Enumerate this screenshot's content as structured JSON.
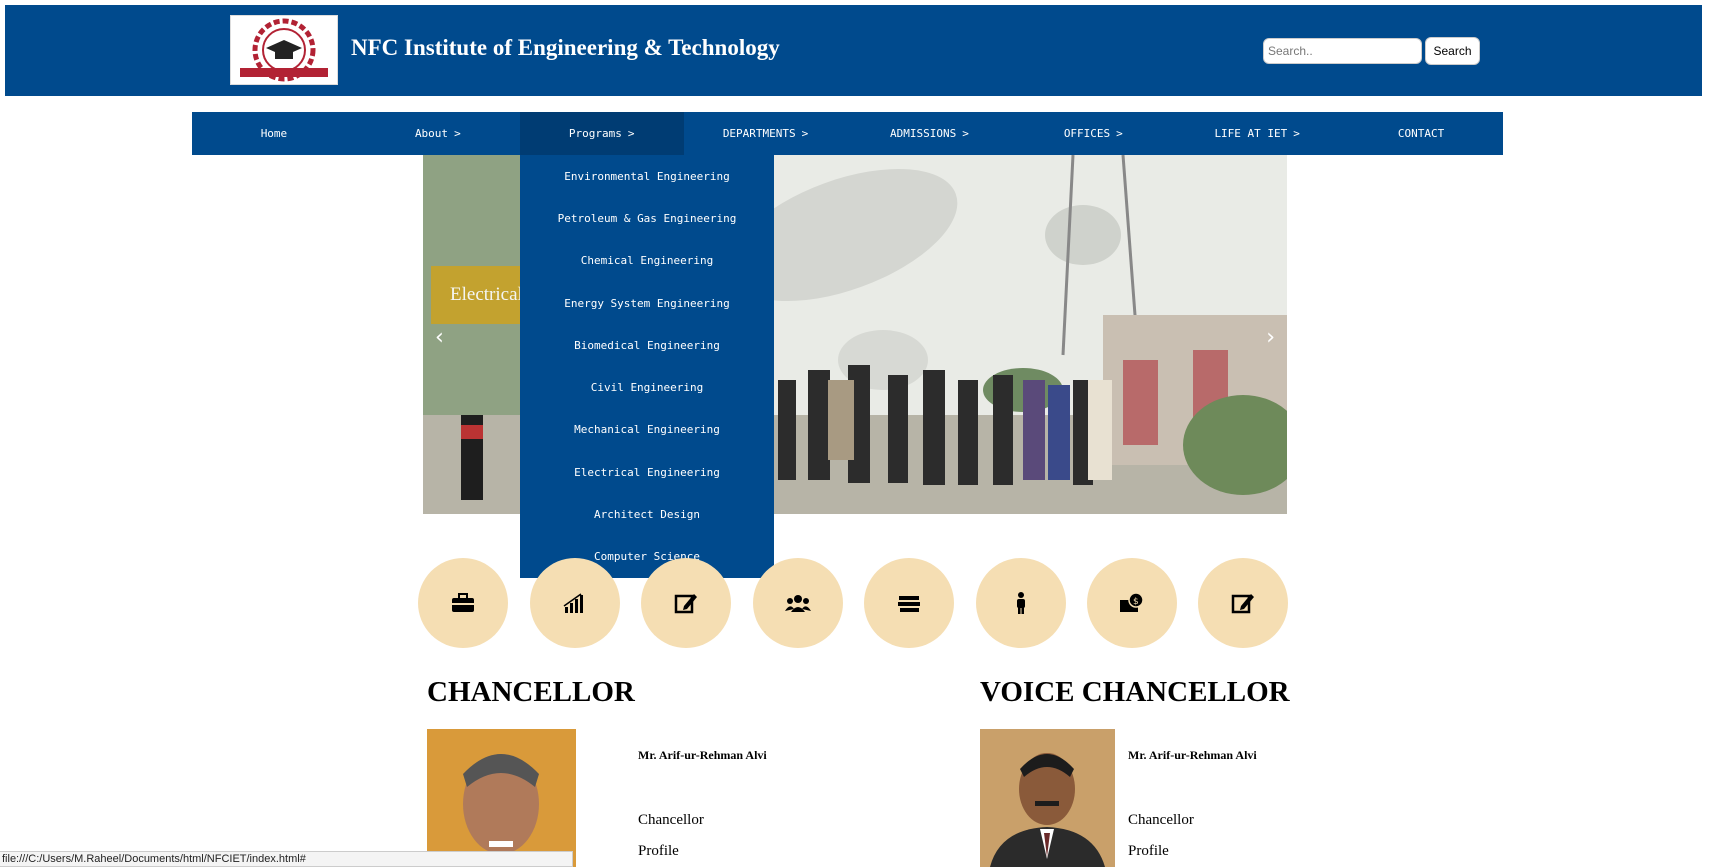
{
  "header": {
    "title": "NFC Institute of Engineering & Technology",
    "search_placeholder": "Search..",
    "search_button": "Search",
    "background": "#004a8d"
  },
  "nav": {
    "items": [
      {
        "label": "Home"
      },
      {
        "label": "About",
        "chevron": ">"
      },
      {
        "label": "Programs",
        "chevron": ">"
      },
      {
        "label": "DEPARTMENTS",
        "chevron": ">"
      },
      {
        "label": "ADMISSIONS",
        "chevron": ">"
      },
      {
        "label": "OFFICES",
        "chevron": ">"
      },
      {
        "label": "LIFE AT IET",
        "chevron": ">"
      },
      {
        "label": "CONTACT"
      }
    ],
    "active": "Programs"
  },
  "programs_menu": {
    "items": [
      "Environmental Engineering",
      "Petroleum & Gas Engineering",
      "Chemical Engineering",
      "Energy System Engineering",
      "Biomedical Engineering",
      "Civil Engineering",
      "Mechanical Engineering",
      "Electrical Engineering",
      "Architect Design",
      "Computer Science"
    ]
  },
  "slider": {
    "caption": "Electrical",
    "prev": "‹",
    "next": "›"
  },
  "quick_links": {
    "icons": [
      "briefcase-icon",
      "bar-chart-icon",
      "edit-icon",
      "users-icon",
      "books-icon",
      "person-icon",
      "money-icon",
      "edit-icon"
    ],
    "color": "#f5deb3"
  },
  "chancellor": {
    "heading": "CHANCELLOR",
    "name": "Mr. Arif-ur-Rehman Alvi",
    "role": "Chancellor",
    "profile": "Profile"
  },
  "vice_chancellor": {
    "heading": "VOICE CHANCELLOR",
    "name": "Mr. Arif-ur-Rehman Alvi",
    "role": "Chancellor",
    "profile": "Profile"
  },
  "status_bar": {
    "url": "file:///C:/Users/M.Raheel/Documents/html/NFCIET/index.html#"
  }
}
